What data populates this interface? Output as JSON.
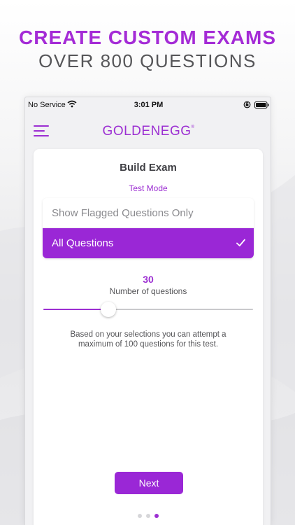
{
  "promo": {
    "headline": "CREATE CUSTOM EXAMS",
    "subheadline": "OVER 800 QUESTIONS"
  },
  "status_bar": {
    "carrier": "No Service",
    "time": "3:01 PM",
    "icons": [
      "wifi-icon",
      "orientation-lock-icon",
      "battery-icon"
    ]
  },
  "nav": {
    "menu_icon": "hamburger-menu-icon",
    "brand_left": "GOLDEN",
    "brand_right": "EGG",
    "brand_mark": "®"
  },
  "build_exam": {
    "title": "Build Exam",
    "mode_label": "Test Mode",
    "options": [
      {
        "label": "Show Flagged Questions Only",
        "selected": false
      },
      {
        "label": "All Questions",
        "selected": true
      }
    ],
    "question_count": "30",
    "question_count_label": "Number of questions",
    "slider_fraction": 0.31,
    "note": "Based on your selections you can attempt a maximum of 100 questions for this test.",
    "next_label": "Next"
  },
  "pager": {
    "pages": 3,
    "active_index": 2
  },
  "colors": {
    "accent": "#9c2fd2",
    "headline": "#a42bd6",
    "selected_option_bg": "#9a27d6",
    "text_dark": "#3f3f44",
    "text_muted": "#8a8a8e"
  }
}
